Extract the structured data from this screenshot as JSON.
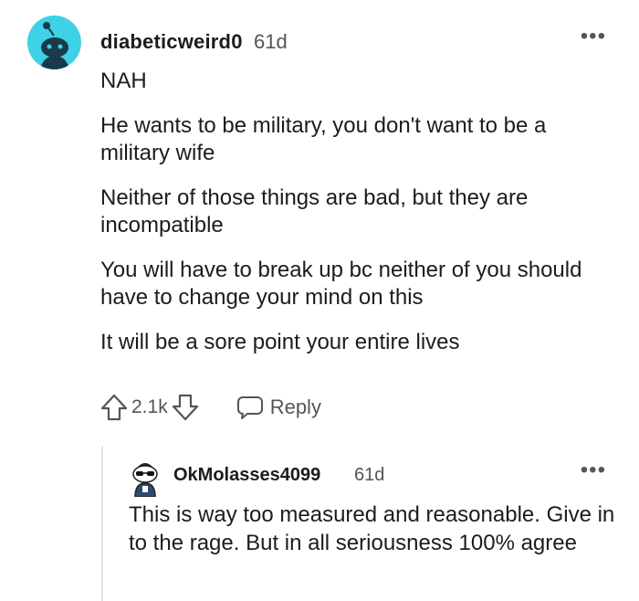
{
  "comment": {
    "username": "diabeticweird0",
    "age": "61d",
    "more_label": "•••",
    "paragraphs": [
      "NAH",
      "He wants to be military, you don't want to be a military wife",
      "Neither of those things are bad, but they are incompatible",
      "You will have to break up bc neither of you should have to change your mind on this",
      "It will be a sore point your entire lives"
    ],
    "score": "2.1k",
    "reply_label": "Reply"
  },
  "reply_comment": {
    "username": "OkMolasses4099",
    "age": "61d",
    "more_label": "•••",
    "text": "This is way too measured and reasonable. Give in to the rage. But in all seriousness 100% agree"
  },
  "colors": {
    "avatar_bg": "#3fd1e6",
    "text": "#1c1c1c",
    "meta": "#555555",
    "thread_line": "#e5e5e5"
  },
  "icons": [
    "snoo-avatar-icon",
    "upvote-arrow-icon",
    "downvote-arrow-icon",
    "comment-bubble-icon",
    "more-options-icon"
  ]
}
